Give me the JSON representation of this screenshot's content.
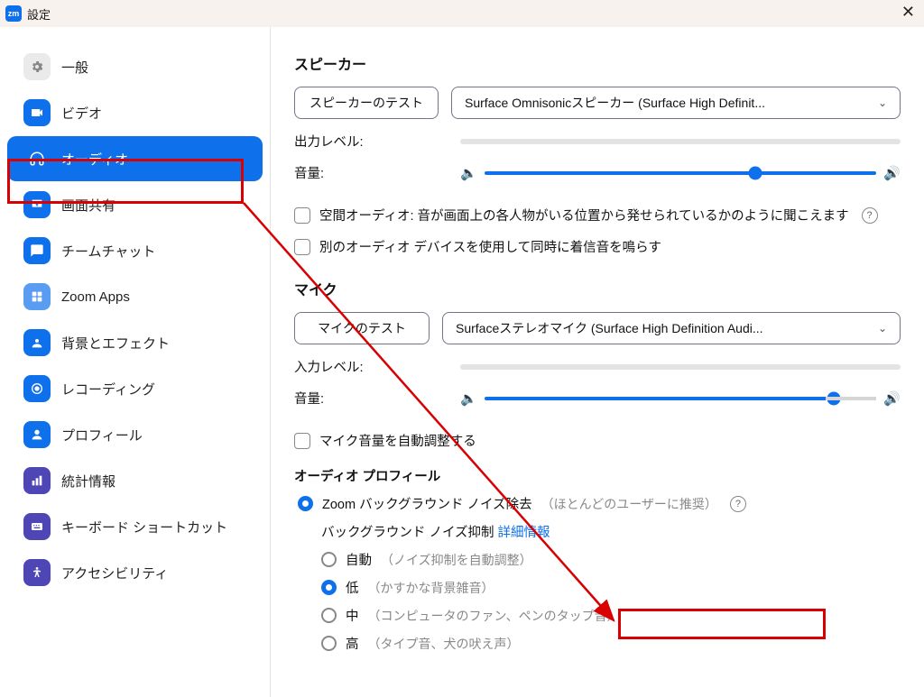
{
  "titlebar": {
    "icon_text": "zm",
    "title": "設定"
  },
  "sidebar": {
    "items": [
      {
        "label": "一般"
      },
      {
        "label": "ビデオ"
      },
      {
        "label": "オーディオ"
      },
      {
        "label": "画面共有"
      },
      {
        "label": "チームチャット"
      },
      {
        "label": "Zoom Apps"
      },
      {
        "label": "背景とエフェクト"
      },
      {
        "label": "レコーディング"
      },
      {
        "label": "プロフィール"
      },
      {
        "label": "統計情報"
      },
      {
        "label": "キーボード ショートカット"
      },
      {
        "label": "アクセシビリティ"
      }
    ]
  },
  "content": {
    "speaker_heading": "スピーカー",
    "speaker_test": "スピーカーのテスト",
    "speaker_device": "Surface Omnisonicスピーカー (Surface High Definit...",
    "output_level": "出力レベル:",
    "volume": "音量:",
    "spatial_audio": "空間オーディオ: 音が画面上の各人物がいる位置から発せられているかのように聞こえます",
    "separate_device": "別のオーディオ デバイスを使用して同時に着信音を鳴らす",
    "mic_heading": "マイク",
    "mic_test": "マイクのテスト",
    "mic_device": "Surfaceステレオマイク (Surface High Definition Audi...",
    "input_level": "入力レベル:",
    "auto_adjust": "マイク音量を自動調整する",
    "profile_heading": "オーディオ プロフィール",
    "zoom_noise": "Zoom バックグラウンド ノイズ除去",
    "zoom_noise_note": "（ほとんどのユーザーに推奨）",
    "bg_suppress": "バックグラウンド ノイズ抑制",
    "more_info": "詳細情報",
    "opt_auto": "自動",
    "opt_auto_note": "（ノイズ抑制を自動調整）",
    "opt_low": "低",
    "opt_low_note": "（かすかな背景雑音）",
    "opt_med": "中",
    "opt_med_note": "（コンピュータのファン、ペンのタップ音）",
    "opt_high": "高",
    "opt_high_note": "（タイプ音、犬の吠え声）"
  }
}
